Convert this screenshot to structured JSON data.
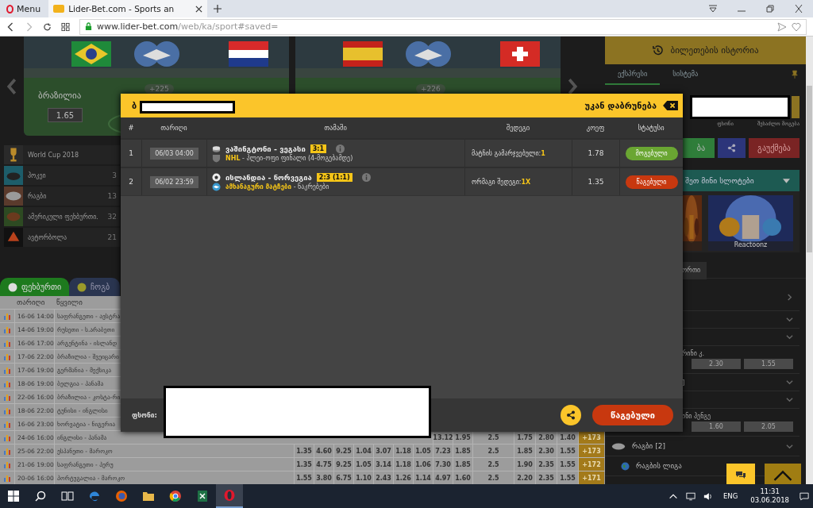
{
  "browser": {
    "menu_label": "Menu",
    "tab_title": "Lider-Bet.com - Sports an",
    "url_host": "www.lider-bet.com",
    "url_path": "/web/ka/sport#saved="
  },
  "banners": [
    {
      "team": "ბრაზილია",
      "odd": "1.65",
      "more": "+225"
    },
    {
      "more": "+226"
    }
  ],
  "sports": [
    {
      "name": "World Cup 2018",
      "kind": "cup"
    },
    {
      "name": "ჰოკეი",
      "count": "3",
      "kind": "hockey"
    },
    {
      "name": "რაგბი",
      "count": "13",
      "kind": "rugby"
    },
    {
      "name": "ამერიკული ფეხბურთი.",
      "count": "32",
      "kind": "american"
    },
    {
      "name": "ავტორბოლა",
      "count": "21",
      "kind": "racing"
    }
  ],
  "sport_tabs": [
    {
      "label": "ფეხბურთი",
      "selected": true
    },
    {
      "label": "ჩოგბ",
      "selected": false
    }
  ],
  "matches": {
    "columns": [
      "თარიღი",
      "წყვილი"
    ],
    "rows": [
      {
        "date": "16-06 14:00",
        "pair": "საფრანგეთი - ავსტრა"
      },
      {
        "date": "14-06 19:00",
        "pair": "რუსეთი - ს.არაბეთი"
      },
      {
        "date": "16-06 17:00",
        "pair": "არგენტინა - ისლანდ"
      },
      {
        "date": "17-06 22:00",
        "pair": "ბრაზილია - შვეიცარი"
      },
      {
        "date": "17-06 19:00",
        "pair": "გერმანია - მექსიკა"
      },
      {
        "date": "18-06 19:00",
        "pair": "ბელგია - პანამა"
      },
      {
        "date": "22-06 16:00",
        "pair": "ბრაზილია - კოსტა-რი"
      },
      {
        "date": "18-06 22:00",
        "pair": "ტუნისი - ინგლისი"
      },
      {
        "date": "16-06 23:00",
        "pair": "ხორვატია - ნიგერია"
      },
      {
        "date": "24-06 16:00",
        "pair": "ინგლისი - პანამა",
        "odds": [
          "13.12",
          "1.95",
          "2.5",
          "1.75",
          "2.80",
          "1.40",
          "+173"
        ]
      },
      {
        "date": "25-06 22:00",
        "pair": "ესპანეთი - მაროკო",
        "odds": [
          "1.35",
          "4.60",
          "9.25",
          "1.04",
          "3.07",
          "1.18",
          "1.05",
          "7.23",
          "1.85",
          "2.5",
          "1.85",
          "2.30",
          "1.55",
          "+173"
        ]
      },
      {
        "date": "21-06 19:00",
        "pair": "საფრანგეთი - პერუ",
        "odds": [
          "1.35",
          "4.75",
          "9.25",
          "1.05",
          "3.14",
          "1.18",
          "1.06",
          "7.30",
          "1.85",
          "2.5",
          "1.90",
          "2.35",
          "1.55",
          "+172"
        ]
      },
      {
        "date": "20-06 16:00",
        "pair": "პორტუგალია - მაროკო",
        "odds": [
          "1.55",
          "3.80",
          "6.75",
          "1.10",
          "2.43",
          "1.26",
          "1.14",
          "4.97",
          "1.60",
          "2.5",
          "2.20",
          "2.35",
          "1.55",
          "+171"
        ]
      }
    ]
  },
  "right_panel": {
    "title": "ბილეთების ისტორია",
    "tabs": [
      {
        "label": "ექსპრესი",
        "selected": true
      },
      {
        "label": "სისტემა",
        "selected": false
      }
    ],
    "field_labels": [
      "ფსონი",
      "შესაძლო მოგება"
    ],
    "buttons": [
      {
        "label": "ბა",
        "kind": "confirm"
      },
      {
        "kind": "share"
      },
      {
        "label": "გაუქმება",
        "kind": "cancel"
      }
    ],
    "slots_title": "შეთ მინი სლოტები",
    "slots": [
      {
        "kind": "picture"
      },
      {
        "kind": "picture",
        "caption": "Reactoonz"
      }
    ],
    "sub_tab": "ორთი",
    "events": [
      {
        "kind": "link"
      },
      {
        "kind": "group"
      },
      {
        "kind": "group"
      },
      {
        "kind": "match",
        "name": "რინი კ.",
        "odds": [
          "2.30",
          "1.55"
        ]
      },
      {
        "kind": "group",
        "name": "]"
      },
      {
        "kind": "group"
      },
      {
        "kind": "match",
        "name": "ინი ჰენგე",
        "odds": [
          "1.60",
          "2.05"
        ]
      },
      {
        "kind": "sport",
        "name": "რაგბი [2]"
      },
      {
        "kind": "league",
        "name": "რაგბის ლიგა"
      }
    ]
  },
  "modal": {
    "title_prefix": "ბ",
    "back_label": "უკან დაბრუნება",
    "columns": [
      "#",
      "თარიღი",
      "თამაში",
      "შედეგი",
      "კოეფ",
      "სტატუსი"
    ],
    "rows": [
      {
        "index": "1",
        "date": "06/03 04:00",
        "kind": "hockey",
        "game": "ვაშინგტონი - ვეგასი",
        "score": "3:1",
        "league": {
          "name": "NHL",
          "rest": " - პლეი-ოფი ფინალი (4-მოგებამდე)",
          "kind": "shield"
        },
        "result_label": "მატჩის გამარჯვებული:",
        "result_value": "1",
        "coef": "1.78",
        "status": {
          "label": "მოგებული",
          "color": "#6aa632"
        }
      },
      {
        "index": "2",
        "date": "06/02 23:59",
        "kind": "football",
        "game": "ისლანდია - ნორვეგია",
        "score": "2:3 (1:1)",
        "league": {
          "name": "ამხანაგური მატჩები",
          "rest": " - ნაკრებები",
          "kind": "handshake"
        },
        "result_label": "ორმაგი შედეგი:",
        "result_value": "1X",
        "coef": "1.35",
        "status": {
          "label": "წაგებული",
          "color": "#c8380f"
        }
      }
    ],
    "stake_label": "ფსონი:",
    "ticket_status": {
      "label": "წაგებული",
      "color": "#c8380f"
    }
  },
  "taskbar": {
    "apps": [
      {
        "kind": "start",
        "active": false
      },
      {
        "kind": "search",
        "active": false
      },
      {
        "kind": "taskview",
        "active": false
      },
      {
        "kind": "edge",
        "active": false
      },
      {
        "kind": "firefox",
        "active": false
      },
      {
        "kind": "folder",
        "active": false
      },
      {
        "kind": "chrome",
        "active": false
      },
      {
        "kind": "sheet",
        "active": false
      },
      {
        "kind": "opera",
        "active": true
      }
    ],
    "lang": "ENG",
    "time": "11:31",
    "date": "03.06.2018"
  }
}
